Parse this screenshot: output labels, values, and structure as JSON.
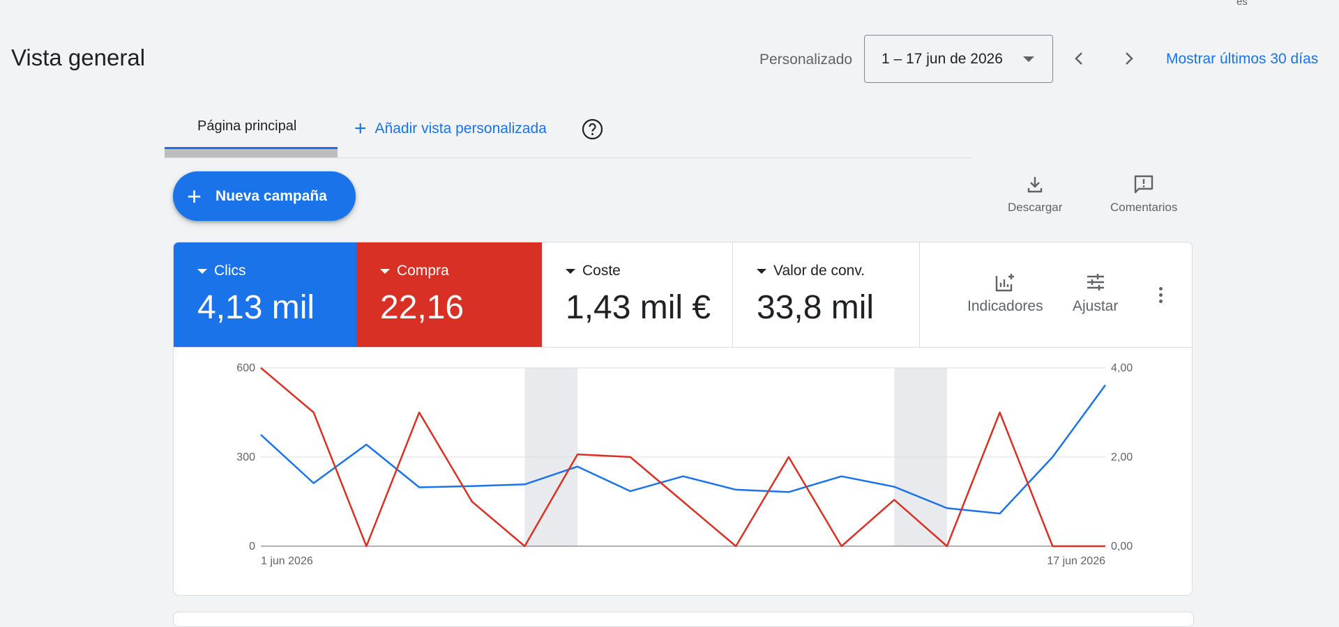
{
  "top_cut_text": "es",
  "header": {
    "title": "Vista general",
    "range_type": "Personalizado",
    "date_range": "1 – 17 jun de 2026",
    "show_last_30": "Mostrar últimos 30 días"
  },
  "tabs": {
    "home": "Página principal",
    "add_view": "Añadir vista personalizada"
  },
  "actions": {
    "new_campaign": "Nueva campaña",
    "download": "Descargar",
    "feedback": "Comentarios"
  },
  "metrics": [
    {
      "name": "Clics",
      "value": "4,13 mil",
      "color": "#1a73e8"
    },
    {
      "name": "Compra",
      "value": "22,16",
      "color": "#d93025"
    },
    {
      "name": "Coste",
      "value": "1,43 mil €"
    },
    {
      "name": "Valor de conv.",
      "value": "33,8 mil"
    }
  ],
  "card_tools": {
    "indicators": "Indicadores",
    "adjust": "Ajustar"
  },
  "colors": {
    "accent": "#1a73e8",
    "red": "#d93025",
    "text": "#202124",
    "muted": "#5f6368"
  },
  "chart_data": {
    "type": "line",
    "x": [
      "1 jun 2026",
      "2 jun 2026",
      "3 jun 2026",
      "4 jun 2026",
      "5 jun 2026",
      "6 jun 2026",
      "7 jun 2026",
      "8 jun 2026",
      "9 jun 2026",
      "10 jun 2026",
      "11 jun 2026",
      "12 jun 2026",
      "13 jun 2026",
      "14 jun 2026",
      "15 jun 2026",
      "16 jun 2026",
      "17 jun 2026"
    ],
    "x_tick_labels": [
      "1 jun 2026",
      "17 jun 2026"
    ],
    "shaded_ranges": [
      [
        5,
        6
      ],
      [
        12,
        13
      ]
    ],
    "grid": true,
    "y_left": {
      "ticks": [
        "600",
        "300",
        "0"
      ],
      "min": 0,
      "max": 600
    },
    "y_right": {
      "ticks": [
        "4,00",
        "2,00",
        "0,00"
      ],
      "min": 0,
      "max": 4
    },
    "series": [
      {
        "name": "Clics",
        "axis": "left",
        "color": "#1a73e8",
        "values": [
          375,
          212,
          342,
          198,
          202,
          208,
          268,
          185,
          235,
          190,
          182,
          235,
          200,
          128,
          110,
          300,
          542
        ]
      },
      {
        "name": "Compra",
        "axis": "right",
        "color": "#d93025",
        "values": [
          4.0,
          3.0,
          0.0,
          3.0,
          1.0,
          0.0,
          2.06,
          2.0,
          1.0,
          0.0,
          2.0,
          0.0,
          1.04,
          0.0,
          3.0,
          0.0,
          0.0
        ]
      }
    ]
  }
}
